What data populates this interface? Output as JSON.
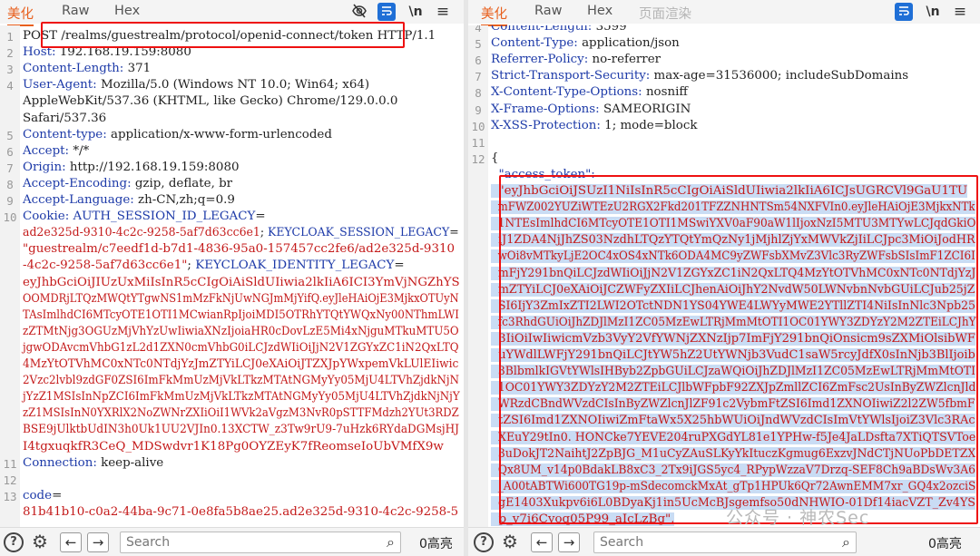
{
  "left": {
    "tabs": [
      "美化",
      "Raw",
      "Hex"
    ],
    "wrap_icon": "\\n",
    "menu_icon": "≡",
    "lines": [
      {
        "n": "1",
        "segs": [
          {
            "t": "POST /realms/guestrealm/protocol/openid-connect/token HTTP/1.1",
            "c": "hv"
          }
        ]
      },
      {
        "n": "2",
        "segs": [
          {
            "t": "Host: ",
            "c": "hk"
          },
          {
            "t": "192.168.19.159:8080",
            "c": "hv"
          }
        ]
      },
      {
        "n": "3",
        "segs": [
          {
            "t": "Content-Length: ",
            "c": "hk"
          },
          {
            "t": "371",
            "c": "hv"
          }
        ]
      },
      {
        "n": "4",
        "segs": [
          {
            "t": "User-Agent: ",
            "c": "hk"
          },
          {
            "t": "Mozilla/5.0 (Windows NT 10.0; Win64; x64)",
            "c": "hv"
          }
        ]
      },
      {
        "n": "",
        "segs": [
          {
            "t": "AppleWebKit/537.36 (KHTML, like Gecko) Chrome/129.0.0.0",
            "c": "hv"
          }
        ]
      },
      {
        "n": "",
        "segs": [
          {
            "t": "Safari/537.36",
            "c": "hv"
          }
        ]
      },
      {
        "n": "5",
        "segs": [
          {
            "t": "Content-type: ",
            "c": "hk"
          },
          {
            "t": "application/x-www-form-urlencoded",
            "c": "hv"
          }
        ]
      },
      {
        "n": "6",
        "segs": [
          {
            "t": "Accept: ",
            "c": "hk"
          },
          {
            "t": "*/*",
            "c": "hv"
          }
        ]
      },
      {
        "n": "7",
        "segs": [
          {
            "t": "Origin: ",
            "c": "hk"
          },
          {
            "t": "http://192.168.19.159:8080",
            "c": "hv"
          }
        ]
      },
      {
        "n": "8",
        "segs": [
          {
            "t": "Accept-Encoding: ",
            "c": "hk"
          },
          {
            "t": "gzip, deflate, br",
            "c": "hv"
          }
        ]
      },
      {
        "n": "9",
        "segs": [
          {
            "t": "Accept-Language: ",
            "c": "hk"
          },
          {
            "t": "zh-CN,zh;q=0.9",
            "c": "hv"
          }
        ]
      },
      {
        "n": "10",
        "segs": [
          {
            "t": "Cookie: ",
            "c": "hk"
          },
          {
            "t": "AUTH_SESSION_ID_LEGACY",
            "c": "blue"
          },
          {
            "t": "=",
            "c": "hv"
          }
        ]
      },
      {
        "n": "",
        "segs": [
          {
            "t": "ad2e325d-9310-4c2c-9258-5af7d63cc6e1",
            "c": "red"
          },
          {
            "t": "; ",
            "c": "hv"
          },
          {
            "t": "KEYCLOAK_SESSION_LEGACY",
            "c": "blue"
          },
          {
            "t": "=",
            "c": "hv"
          }
        ]
      },
      {
        "n": "",
        "segs": [
          {
            "t": "\"guestrealm/c7eedf1d-b7d1-4836-95a0-157457cc2fe6/ad2e325d-9310",
            "c": "red"
          }
        ]
      },
      {
        "n": "",
        "segs": [
          {
            "t": "-4c2c-9258-5af7d63cc6e1\"",
            "c": "red"
          },
          {
            "t": "; ",
            "c": "hv"
          },
          {
            "t": "KEYCLOAK_IDENTITY_LEGACY",
            "c": "blue"
          },
          {
            "t": "=",
            "c": "hv"
          }
        ]
      },
      {
        "n": "",
        "segs": [
          {
            "t": "eyJhbGciOiJIUzUxMiIsInR5cCIgOiAiSldUIiwia2lkIiA6ICI3YmVjNGZhYS",
            "c": "red"
          }
        ]
      },
      {
        "n": "",
        "segs": [
          {
            "t": "OOMDRjLTQzMWQtYTgwNS1mMzFkNjUwNGJmMjYifQ.eyJleHAiOjE3MjkxOTUyN",
            "c": "red"
          }
        ]
      },
      {
        "n": "",
        "segs": [
          {
            "t": "TAsImlhdCI6MTcyOTE1OTI1MCwianRpIjoiMDI5OTRhYTQtYWQxNy00NThmLWI",
            "c": "red"
          }
        ]
      },
      {
        "n": "",
        "segs": [
          {
            "t": "zZTMtNjg3OGUzMjVhYzUwIiwiaXNzIjoiaHR0cDovLzE5Mi4xNjguMTkuMTU5O",
            "c": "red"
          }
        ]
      },
      {
        "n": "",
        "segs": [
          {
            "t": "jgwODAvcmVhbG1zL2d1ZXN0cmVhbG0iLCJzdWIiOiJjN2V1ZGYxZC1iN2QxLTQ",
            "c": "red"
          }
        ]
      },
      {
        "n": "",
        "segs": [
          {
            "t": "4MzYtOTVhMC0xNTc0NTdjYzJmZTYiLCJ0eXAiOiJTZXJpYWxpemVkLUlEIiwic",
            "c": "red"
          }
        ]
      },
      {
        "n": "",
        "segs": [
          {
            "t": "2Vzc2lvbl9zdGF0ZSI6ImFkMmUzMjVkLTkzMTAtNGMyYy05MjU4LTVhZjdkNjN",
            "c": "red"
          }
        ]
      },
      {
        "n": "",
        "segs": [
          {
            "t": "jYzZ1MSIsInNpZCI6ImFkMmUzMjVkLTkzMTAtNGMyYy05MjU4LTVhZjdkNjNjY",
            "c": "red"
          }
        ]
      },
      {
        "n": "",
        "segs": [
          {
            "t": "zZ1MSIsInN0YXRlX2NoZWNrZXIiOiI1WVk2aVgzM3NvR0pSTTFMdzh2YUt3RDZ",
            "c": "red"
          }
        ]
      },
      {
        "n": "",
        "segs": [
          {
            "t": "BSE9jUlktbUdIN3h0Uk1UU2VJIn0.13XCTW_z3Tw9rU9-7uHzk6RYdaDGMsjHJ",
            "c": "red"
          }
        ]
      },
      {
        "n": "",
        "segs": [
          {
            "t": "I4tgxuqkfR3CeQ_MDSwdvr1K18Pg0OYZEyK7fReomseIoUbVMfX9w",
            "c": "red"
          }
        ]
      },
      {
        "n": "11",
        "segs": [
          {
            "t": "Connection: ",
            "c": "hk"
          },
          {
            "t": "keep-alive",
            "c": "hv"
          }
        ]
      },
      {
        "n": "12",
        "segs": [
          {
            "t": "",
            "c": "hv"
          }
        ]
      },
      {
        "n": "13",
        "segs": [
          {
            "t": "code",
            "c": "blue"
          },
          {
            "t": "=",
            "c": "hv"
          }
        ]
      },
      {
        "n": "",
        "segs": [
          {
            "t": "81b41b10-c0a2-44ba-9c71-0e8fa5b8ae25.ad2e325d-9310-4c2c-9258-5",
            "c": "red"
          }
        ]
      }
    ],
    "search_placeholder": "Search",
    "match_count": "0高亮"
  },
  "right": {
    "tabs": [
      "美化",
      "Raw",
      "Hex",
      "页面渲染"
    ],
    "wrap_icon": "\\n",
    "menu_icon": "≡",
    "lines": [
      {
        "n": "4",
        "segs": [
          {
            "t": "Content-Length: ",
            "c": "hk"
          },
          {
            "t": "3599",
            "c": "hv"
          }
        ]
      },
      {
        "n": "5",
        "segs": [
          {
            "t": "Content-Type: ",
            "c": "hk"
          },
          {
            "t": "application/json",
            "c": "hv"
          }
        ]
      },
      {
        "n": "6",
        "segs": [
          {
            "t": "Referrer-Policy: ",
            "c": "hk"
          },
          {
            "t": "no-referrer",
            "c": "hv"
          }
        ]
      },
      {
        "n": "7",
        "segs": [
          {
            "t": "Strict-Transport-Security: ",
            "c": "hk"
          },
          {
            "t": "max-age=31536000; includeSubDomains",
            "c": "hv"
          }
        ]
      },
      {
        "n": "8",
        "segs": [
          {
            "t": "X-Content-Type-Options: ",
            "c": "hk"
          },
          {
            "t": "nosniff",
            "c": "hv"
          }
        ]
      },
      {
        "n": "9",
        "segs": [
          {
            "t": "X-Frame-Options: ",
            "c": "hk"
          },
          {
            "t": "SAMEORIGIN",
            "c": "hv"
          }
        ]
      },
      {
        "n": "10",
        "segs": [
          {
            "t": "X-XSS-Protection: ",
            "c": "hk"
          },
          {
            "t": "1; mode=block",
            "c": "hv"
          }
        ]
      },
      {
        "n": "11",
        "segs": [
          {
            "t": "",
            "c": "hv"
          }
        ]
      },
      {
        "n": "12",
        "segs": [
          {
            "t": "{",
            "c": "hv"
          }
        ]
      },
      {
        "n": "",
        "segs": [
          {
            "t": "  \"access_token\":",
            "c": "hk"
          }
        ]
      },
      {
        "n": "",
        "segs": [
          {
            "t": "  \"eyJhbGciOiJSUzI1NiIsInR5cCIgOiAiSldUIiwia2lkIiA6ICJsUGRCVl9GaU1TU",
            "c": "red sel"
          }
        ]
      },
      {
        "n": "",
        "segs": [
          {
            "t": "  mFWZ002YUZiWTEzU2RGX2Fkd201TFZZNHNTSm54NXFVIn0.eyJleHAiOjE3MjkxNTk",
            "c": "red sel"
          }
        ]
      },
      {
        "n": "",
        "segs": [
          {
            "t": "  1NTEsImlhdCI6MTcyOTE1OTI1MSwiYXV0aF90aW1lIjoxNzI5MTU3MTYwLCJqdGkiO",
            "c": "red sel"
          }
        ]
      },
      {
        "n": "",
        "segs": [
          {
            "t": "  iJ1ZDA4NjJhZS03NzdhLTQzYTQtYmQzNy1jMjhlZjYxMWVkZjIiLCJpc3MiOiJodHR",
            "c": "red sel"
          }
        ]
      },
      {
        "n": "",
        "segs": [
          {
            "t": "  wOi8vMTkyLjE2OC4xOS4xNTk6ODA4MC9yZWFsbXMvZ3Vlc3RyZWFsbSIsImF1ZCI6I",
            "c": "red sel"
          }
        ]
      },
      {
        "n": "",
        "segs": [
          {
            "t": "  mFjY291bnQiLCJzdWIiOiJjN2V1ZGYxZC1iN2QxLTQ4MzYtOTVhMC0xNTc0NTdjYzJ",
            "c": "red sel"
          }
        ]
      },
      {
        "n": "",
        "segs": [
          {
            "t": "  mZTYiLCJ0eXAiOiJCZWFyZXIiLCJhenAiOiJhY2NvdW50LWNvbnNvbGUiLCJub25jZ",
            "c": "red sel"
          }
        ]
      },
      {
        "n": "",
        "segs": [
          {
            "t": "  SI6IjY3ZmIxZTI2LWI2OTctNDN1YS04YWE4LWYyMWE2YTllZTI4NiIsInNlc3Npb25",
            "c": "red sel"
          }
        ]
      },
      {
        "n": "",
        "segs": [
          {
            "t": "  fc3RhdGUiOiJhZDJlMzI1ZC05MzEwLTRjMmMtOTI1OC01YWY3ZDYzY2M2ZTEiLCJhY",
            "c": "red sel"
          }
        ]
      },
      {
        "n": "",
        "segs": [
          {
            "t": "  3IiOiIwIiwicmVzb3VyY2VfYWNjZXNzIjp7ImFjY291bnQiOnsicm9sZXMiOlsibWF",
            "c": "red sel"
          }
        ]
      },
      {
        "n": "",
        "segs": [
          {
            "t": "  uYWdlLWFjY291bnQiLCJtYW5hZ2UtYWNjb3VudC1saW5rcyJdfX0sInNjb3BlIjoib",
            "c": "red sel"
          }
        ]
      },
      {
        "n": "",
        "segs": [
          {
            "t": "  3BlbmlkIGVtYWlsIHByb2ZpbGUiLCJzaWQiOiJhZDJlMzI1ZC05MzEwLTRjMmMtOTI",
            "c": "red sel"
          }
        ]
      },
      {
        "n": "",
        "segs": [
          {
            "t": "  1OC01YWY3ZDYzY2M2ZTEiLCJlbWFpbF92ZXJpZmllZCI6ZmFsc2UsInByZWZlcnJld",
            "c": "red sel"
          }
        ]
      },
      {
        "n": "",
        "segs": [
          {
            "t": "  WRzdCBndWVzdCIsInByZWZlcnJlZF91c2VybmFtZSI6Imd1ZXNOIiwiZ2l2ZW5fbmF",
            "c": "red sel"
          }
        ]
      },
      {
        "n": "",
        "segs": [
          {
            "t": "  tZSI6Imd1ZXNOIiwiZmFtaWx5X25hbWUiOiJndWVzdCIsImVtYWlsIjoiZ3Vlc3RAc",
            "c": "red sel"
          }
        ]
      },
      {
        "n": "",
        "segs": [
          {
            "t": "  XEuY29tIn0. HONCke7YEVE204ruPXGdYL81e1YPHw-f5Je4JaLDsfta7XTiQTSVToe",
            "c": "red sel"
          }
        ]
      },
      {
        "n": "",
        "segs": [
          {
            "t": "  3uDokJT2NaihtJ2ZpBJG_M1uCyZAuSLKyYkItuczKgmug6ExzvJNdCTjNUoPbDETZX",
            "c": "red sel"
          }
        ]
      },
      {
        "n": "",
        "segs": [
          {
            "t": "  Qx8UM_v14p0BdakLB8xC3_2Tx9iJGS5yc4_RPypWzzaV7Drzq-SEF8Ch9aBDsWv3A6",
            "c": "red sel"
          }
        ]
      },
      {
        "n": "",
        "segs": [
          {
            "t": "  _A00tABTWi600TG19p-mSdecomckMxAt_gTp1HPUk6Qr72AwnEMM7xr_GQ4x2ozciS",
            "c": "red sel"
          }
        ]
      },
      {
        "n": "",
        "segs": [
          {
            "t": "  gE1403Xukpv6i6L0BDyaKj1in5UcMcBJsgemfso50dNHWIO-01Df14iacVZT_Zv4YS",
            "c": "red sel"
          }
        ]
      },
      {
        "n": "",
        "segs": [
          {
            "t": "  p_v7i6Cvoq05P99_aIcLzBg\",",
            "c": "red sel"
          }
        ]
      }
    ],
    "search_placeholder": "Search",
    "match_count": "0高亮",
    "watermark": "公众号 · 神农Sec"
  },
  "colors": {
    "accent": "#e8601e",
    "header_key": "#1d3aa8",
    "value_red": "#c41a1a",
    "highlight_box": "#e11111",
    "selection": "#c9dcf4"
  },
  "icons": {
    "eye_off": "eye-off-icon",
    "wrap": "word-wrap-icon",
    "newline": "newline-icon",
    "menu": "menu-icon",
    "help": "help-icon",
    "settings": "gear-icon",
    "back": "arrow-left-icon",
    "forward": "arrow-right-icon",
    "search": "search-icon"
  }
}
